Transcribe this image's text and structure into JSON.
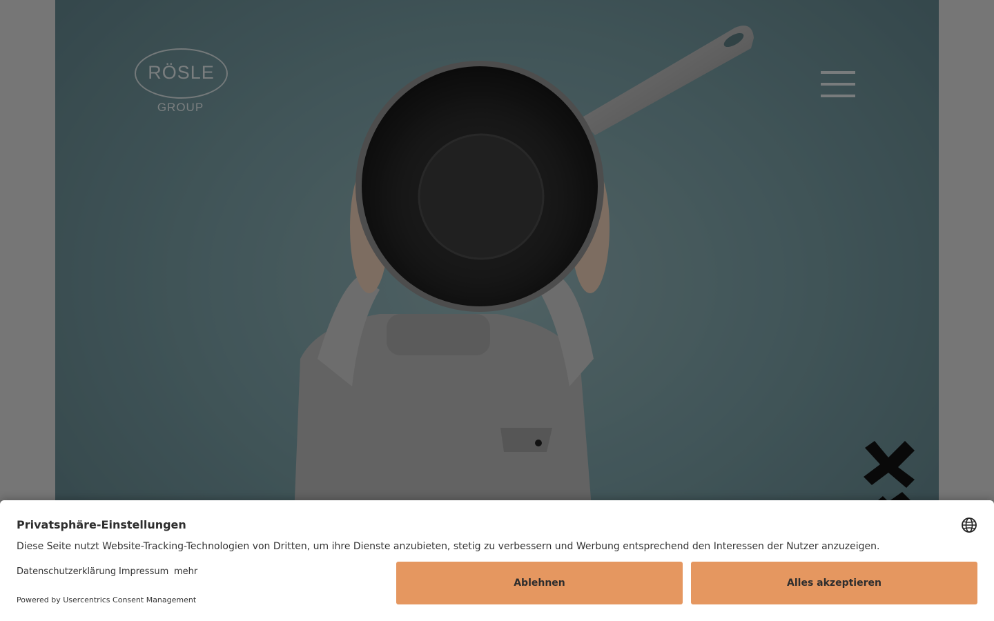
{
  "header": {
    "logo_name": "RÖSLE",
    "logo_sub": "GROUP"
  },
  "consent": {
    "title": "Privatsphäre-Einstellungen",
    "description": "Diese Seite nutzt Website-Tracking-Technologien von Dritten, um ihre Dienste anzubieten, stetig zu verbessern und Werbung entsprechend den Interessen der Nutzer anzuzeigen.",
    "links": {
      "privacy": "Datenschutzerklärung",
      "imprint": "Impressum",
      "more": "mehr"
    },
    "powered_by": "Powered by Usercentrics Consent Management",
    "buttons": {
      "decline": "Ablehnen",
      "accept_all": "Alles akzeptieren"
    },
    "language_icon": "globe-icon"
  },
  "colors": {
    "button_bg": "#e59760",
    "hero_bg": "#7a9fa5",
    "overlay": "#767676"
  }
}
